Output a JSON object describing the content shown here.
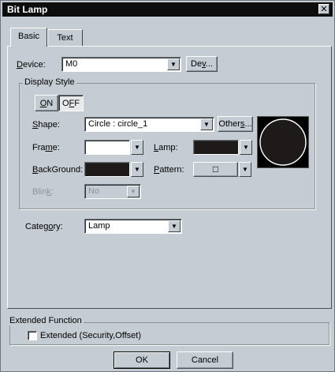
{
  "window": {
    "title": "Bit Lamp",
    "close_glyph": "✕"
  },
  "tabs": [
    {
      "label": "Basic"
    },
    {
      "label": "Text"
    }
  ],
  "device": {
    "label_pre": "",
    "label_u": "D",
    "label_post": "evice:",
    "value": "M0",
    "button_pre": "De",
    "button_u": "v",
    "button_post": "..."
  },
  "display_style": {
    "title": "Display Style",
    "on_u": "O",
    "on_post": "N",
    "off_pre": "O",
    "off_u": "F",
    "off_post": "F",
    "shape": {
      "label_u": "S",
      "label_post": "hape:",
      "value": "Circle : circle_1",
      "others_pre": "Other",
      "others_u": "s",
      "others_post": "..."
    },
    "frame": {
      "label_pre": "Fra",
      "label_u": "m",
      "label_post": "e:",
      "color": "#ffffff"
    },
    "lamp": {
      "label_u": "L",
      "label_post": "amp:",
      "color": "#1e1a1a"
    },
    "background": {
      "label_u": "B",
      "label_post": "ackGround:",
      "color": "#1e1a1a"
    },
    "pattern": {
      "label_u": "P",
      "label_post": "attern:",
      "value": "□"
    },
    "blink": {
      "label_pre": "Blin",
      "label_u": "k",
      "label_post": ":",
      "value": "No"
    },
    "preview_color": "#1e1a1a"
  },
  "category": {
    "label_pre": "Categ",
    "label_u": "o",
    "label_post": "ry:",
    "value": "Lamp"
  },
  "extended": {
    "title": "Extended Function",
    "checkbox_label": "Extended (Security,Offset)",
    "checked": false
  },
  "buttons": {
    "ok": "OK",
    "cancel": "Cancel"
  },
  "icons": {
    "dropdown": "▼"
  }
}
